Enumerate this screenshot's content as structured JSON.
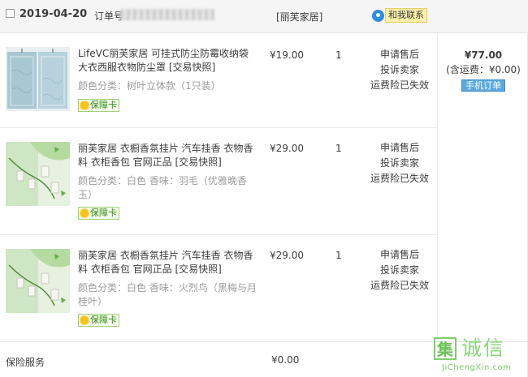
{
  "order": {
    "date": "2019-04-20",
    "order_no_label": "订单号:",
    "shop_name": "[丽芙家居]",
    "contact_label": "和我联系"
  },
  "items": [
    {
      "title": "LifeVC丽芙家居 可挂式防尘防霉收纳袋大衣西服衣物防尘罩 [交易快照]",
      "sku": "颜色分类：树叶立体款（1只装）",
      "badge": "保障卡",
      "price": "¥19.00",
      "qty": "1",
      "service": [
        "申请售后",
        "投诉卖家",
        "运费险已失效"
      ]
    },
    {
      "title": "丽芙家居 衣橱香氛挂片 汽车挂香 衣物香料 衣柜香包 官网正品 [交易快照]",
      "sku": "颜色分类：白色 香味：羽毛（优雅晚香玉）",
      "badge": "保障卡",
      "price": "¥29.00",
      "qty": "1",
      "service": [
        "申请售后",
        "投诉卖家",
        "运费险已失效"
      ]
    },
    {
      "title": "丽芙家居 衣橱香氛挂片 汽车挂香 衣物香料 衣柜香包 官网正品 [交易快照]",
      "sku": "颜色分类：白色 香味：火烈鸟（黑梅与月桂叶）",
      "badge": "保障卡",
      "price": "¥29.00",
      "qty": "1",
      "service": [
        "申请售后",
        "投诉卖家",
        "运费险已失效"
      ]
    }
  ],
  "summary": {
    "total": "¥77.00",
    "shipping": "(含运费：¥0.00)",
    "mobile_order": "手机订单"
  },
  "insurance": {
    "label": "保险服务",
    "price": "¥0.00"
  },
  "watermark": {
    "mark": "集",
    "name": "诚信",
    "url": "JiChengXin.com"
  },
  "colors": {
    "header_bg": "#f5f5f5",
    "badge_green": "#3a8a1a",
    "mobile_button": "#5ba8de",
    "contact_bubble": "#2d8fe0"
  }
}
